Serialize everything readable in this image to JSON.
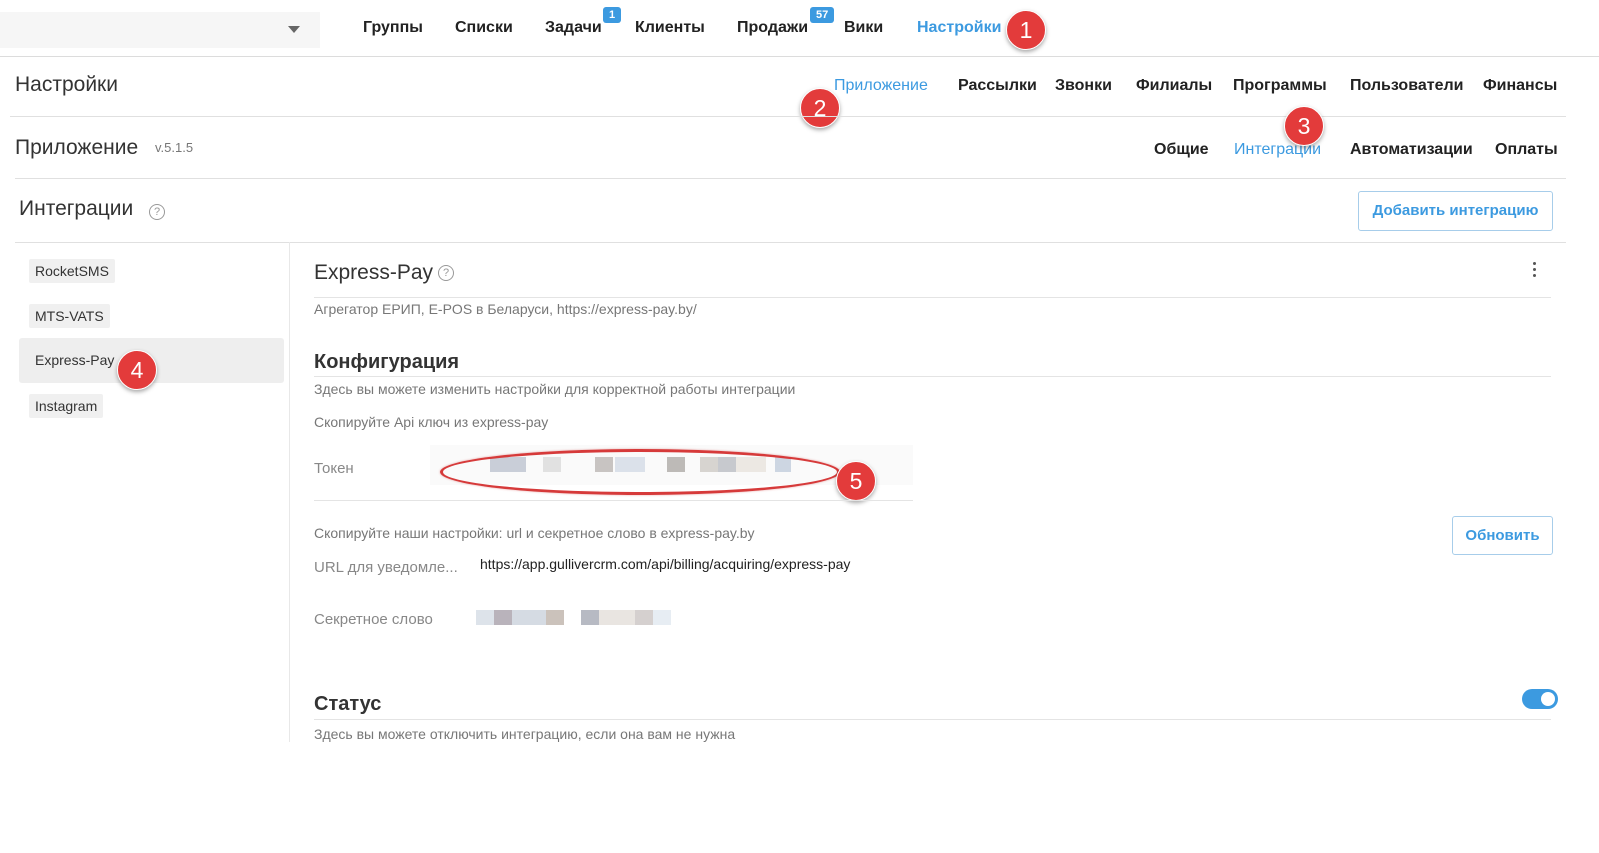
{
  "topnav": {
    "items": [
      "Группы",
      "Списки",
      "Задачи",
      "Клиенты",
      "Продажи",
      "Вики",
      "Настройки"
    ],
    "badges": {
      "tasks": "1",
      "sales": "57"
    },
    "active": "Настройки"
  },
  "settings": {
    "title": "Настройки",
    "subnav": [
      "Приложение",
      "Рассылки",
      "Звонки",
      "Филиалы",
      "Программы",
      "Пользователи",
      "Финансы"
    ],
    "active": "Приложение"
  },
  "app": {
    "title": "Приложение",
    "version": "v.5.1.5",
    "tabs": [
      "Общие",
      "Интеграции",
      "Автоматизации",
      "Оплаты"
    ],
    "active": "Интеграции"
  },
  "integrations": {
    "title": "Интеграции",
    "add_button": "Добавить интеграцию",
    "list": [
      "RocketSMS",
      "MTS-VATS",
      "Express-Pay",
      "Instagram"
    ],
    "selected": "Express-Pay"
  },
  "detail": {
    "title": "Express-Pay",
    "description": "Агрегатор ЕРИП, E-POS в Беларуси, https://express-pay.by/",
    "config": {
      "title": "Конфигурация",
      "subtitle": "Здесь вы можете изменить настройки для корректной работы интеграции",
      "api_hint": "Скопируйте Api ключ из express-pay",
      "token_label": "Токен",
      "settings_hint": "Скопируйте наши настройки: url и секретное слово в express-pay.by",
      "refresh_button": "Обновить",
      "url_label": "URL для уведомле...",
      "url_value": "https://app.gullivercrm.com/api/billing/acquiring/express-pay",
      "secret_label": "Секретное слово"
    },
    "status": {
      "title": "Статус",
      "subtitle": "Здесь вы можете отключить интеграцию, если она вам не нужна",
      "enabled": true
    }
  },
  "help_glyph": "?",
  "markers": [
    "1",
    "2",
    "3",
    "4",
    "5"
  ],
  "colors": {
    "accent": "#3c9ae0",
    "marker": "#e33b3b"
  }
}
